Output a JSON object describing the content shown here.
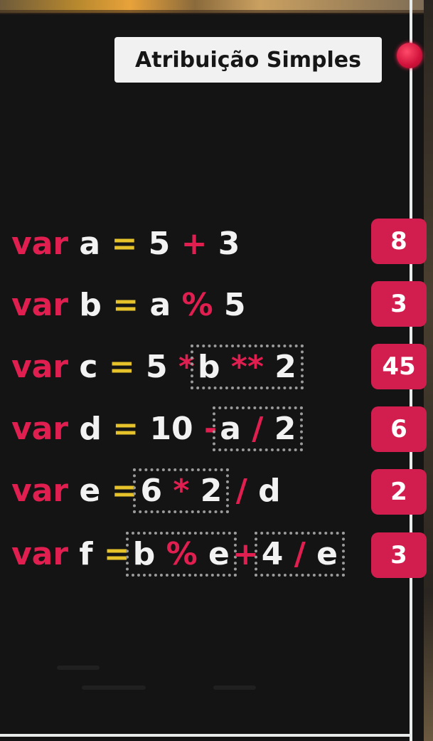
{
  "title": "Atribuição Simples",
  "rows": [
    {
      "kw": "var",
      "name": "a",
      "eq": "=",
      "p1": "5",
      "op1": "+",
      "p2": "3",
      "result": "8"
    },
    {
      "kw": "var",
      "name": "b",
      "eq": "=",
      "p1": "a",
      "op1": "%",
      "p2": "5",
      "result": "3"
    },
    {
      "kw": "var",
      "name": "c",
      "eq": "=",
      "p1": "5",
      "op1": "*",
      "g1a": "b",
      "g1op": "**",
      "g1b": "2",
      "result": "45"
    },
    {
      "kw": "var",
      "name": "d",
      "eq": "=",
      "p1": "10",
      "op1": "-",
      "g1a": "a",
      "g1op": "/",
      "g1b": "2",
      "result": "6"
    },
    {
      "kw": "var",
      "name": "e",
      "eq": "=",
      "g1a": "6",
      "g1op": "*",
      "g1b": "2",
      "op1": "/",
      "p2": "d",
      "result": "2"
    },
    {
      "kw": "var",
      "name": "f",
      "eq": "=",
      "g1a": "b",
      "g1op": "%",
      "g1b": "e",
      "op1": "+",
      "g2a": "4",
      "g2op": "/",
      "g2b": "e",
      "result": "3"
    }
  ],
  "colors": {
    "keyword": "#e01e4f",
    "equals": "#e6c32a",
    "operator": "#e01e4f",
    "result_badge": "#d21e4e",
    "background": "#141414"
  },
  "icons": {
    "record": "rec-dot-icon"
  }
}
